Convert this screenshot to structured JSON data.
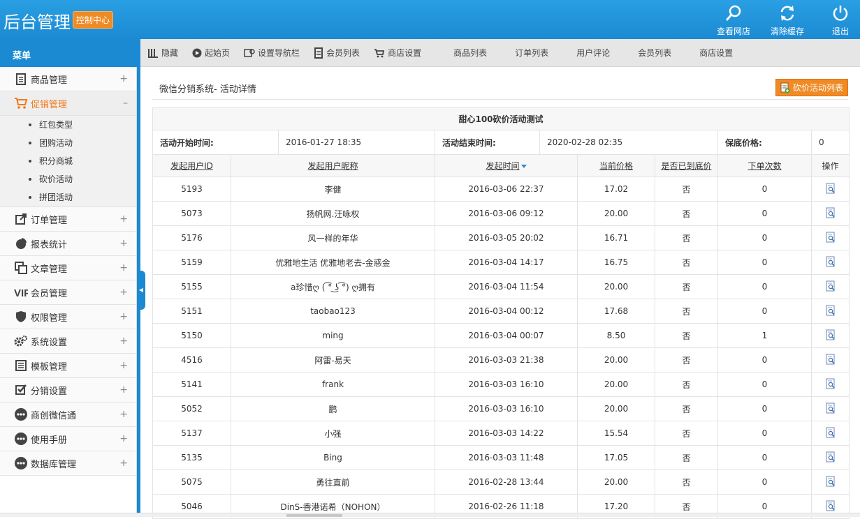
{
  "header": {
    "brand": "后台管理",
    "badge": "控制中心",
    "actions": [
      {
        "label": "查看网店",
        "icon": "search-icon"
      },
      {
        "label": "清除缓存",
        "icon": "refresh-icon"
      },
      {
        "label": "退出",
        "icon": "power-icon"
      }
    ]
  },
  "sidebar": {
    "title": "菜单",
    "items": [
      {
        "label": "商品管理",
        "icon": "goods-icon",
        "toggle": "+"
      },
      {
        "label": "促销管理",
        "icon": "cart-icon",
        "toggle": "–"
      },
      {
        "label": "订单管理",
        "icon": "order-icon",
        "toggle": "+"
      },
      {
        "label": "报表统计",
        "icon": "pie-chart-icon",
        "toggle": "+"
      },
      {
        "label": "文章管理",
        "icon": "article-icon",
        "toggle": "+"
      },
      {
        "label": "会员管理",
        "icon": "vip-icon",
        "toggle": "+"
      },
      {
        "label": "权限管理",
        "icon": "shield-icon",
        "toggle": "+"
      },
      {
        "label": "系统设置",
        "icon": "gear-icon",
        "toggle": "+"
      },
      {
        "label": "模板管理",
        "icon": "template-icon",
        "toggle": "+"
      },
      {
        "label": "分销设置",
        "icon": "checkbox-icon",
        "toggle": "+"
      },
      {
        "label": "商创微信通",
        "icon": "more-icon",
        "toggle": "+"
      },
      {
        "label": "使用手册",
        "icon": "more-icon",
        "toggle": "+"
      },
      {
        "label": "数据库管理",
        "icon": "more-icon",
        "toggle": "+"
      }
    ],
    "submenu": [
      "红包类型",
      "团购活动",
      "积分商城",
      "砍价活动",
      "拼团活动"
    ]
  },
  "tabs": [
    {
      "label": "隐藏",
      "icon": "hide-icon"
    },
    {
      "label": "起始页",
      "icon": "play-icon"
    },
    {
      "label": "设置导航栏",
      "icon": "nav-settings-icon"
    },
    {
      "label": "会员列表",
      "icon": "member-list-icon"
    },
    {
      "label": "商店设置",
      "icon": "shop-settings-icon"
    },
    {
      "label": "商品列表"
    },
    {
      "label": "订单列表"
    },
    {
      "label": "用户评论"
    },
    {
      "label": "会员列表"
    },
    {
      "label": "商店设置"
    }
  ],
  "page": {
    "title": "微信分销系统- 活动详情",
    "list_button": "砍价活动列表"
  },
  "activity": {
    "name": "甜心100砍价活动测试",
    "start_label": "活动开始时间:",
    "start_value": "2016-01-27 18:35",
    "end_label": "活动结束时间:",
    "end_value": "2020-02-28 02:35",
    "reserve_label": "保底价格:",
    "reserve_value": "0"
  },
  "table": {
    "columns": [
      "发起用户ID",
      "发起用户昵称",
      "发起时间",
      "当前价格",
      "是否已到底价",
      "下单次数",
      "操作"
    ],
    "rows": [
      [
        "5193",
        "李健",
        "2016-03-06 22:37",
        "17.02",
        "否",
        "0"
      ],
      [
        "5073",
        "扬帆网.汪咏权",
        "2016-03-06 09:12",
        "20.00",
        "否",
        "0"
      ],
      [
        "5176",
        "风一样的年华",
        "2016-03-05 20:02",
        "16.71",
        "否",
        "0"
      ],
      [
        "5159",
        "优雅地生活 优雅地老去-金惑金",
        "2016-03-04 14:17",
        "16.75",
        "否",
        "0"
      ],
      [
        "5155",
        "a珍惜ღ ( ͡° ͜ʖ ͡°) ღ拥有",
        "2016-03-04 11:54",
        "20.00",
        "否",
        "0"
      ],
      [
        "5151",
        "taobao123",
        "2016-03-04 00:12",
        "17.68",
        "否",
        "0"
      ],
      [
        "5150",
        "ming",
        "2016-03-04 00:07",
        "8.50",
        "否",
        "1"
      ],
      [
        "4516",
        "阿雷-易天",
        "2016-03-03 21:38",
        "20.00",
        "否",
        "0"
      ],
      [
        "5141",
        "frank",
        "2016-03-03 16:10",
        "20.00",
        "否",
        "0"
      ],
      [
        "5052",
        "鹏",
        "2016-03-03 16:10",
        "20.00",
        "否",
        "0"
      ],
      [
        "5137",
        "小强",
        "2016-03-03 14:22",
        "15.54",
        "否",
        "0"
      ],
      [
        "5135",
        "Bing",
        "2016-03-03 11:48",
        "17.05",
        "否",
        "0"
      ],
      [
        "5075",
        "勇往直前",
        "2016-02-28 13:44",
        "20.00",
        "否",
        "0"
      ],
      [
        "5046",
        "DinS-香港诺希（NOHON）",
        "2016-02-26 11:18",
        "17.20",
        "否",
        "0"
      ]
    ]
  }
}
